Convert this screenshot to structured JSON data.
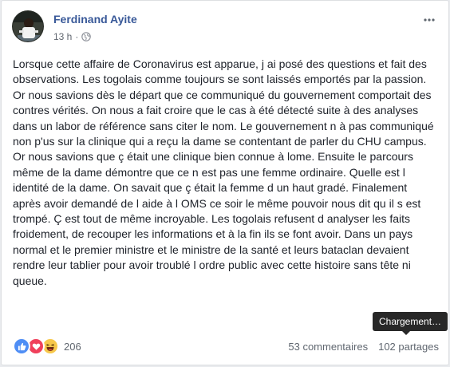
{
  "post": {
    "author": "Ferdinand Ayite",
    "time": "13 h",
    "separator": "·",
    "privacy_icon": "globe-icon",
    "more_icon": "ellipsis-icon",
    "text": "Lorsque cette affaire de Coronavirus est apparue, j ai posé des questions et fait des observations. Les togolais comme toujours se sont laissés emportés par la passion. Or nous savions dès le départ que ce communiqué du gouvernement comportait des contres vérités. On nous a fait croire que le cas à été détecté suite à des analyses dans un labor de référence sans citer le nom. Le gouvernement n à pas communiqué non p'us sur la clinique qui a reçu la dame se contentant de parler du CHU campus. Or nous savions que ç était une clinique bien connue à lome. Ensuite le parcours même de la dame démontre que ce n est pas une femme ordinaire. Quelle est l identité de la dame. On savait que ç était la femme d un haut gradé. Finalement après avoir demandé de l aide à l OMS ce soir le même pouvoir nous dit qu il s est trompé. Ç est tout de même incroyable. Les togolais refusent d analyser les faits froidement, de recouper les informations et à la fin ils se font avoir. Dans un pays normal et le premier ministre et le ministre de la santé et leurs bataclan devaient rendre leur tablier pour avoir troublé l ordre public avec cette histoire sans tête ni queue."
  },
  "footer": {
    "reaction_icons": [
      "like-icon",
      "love-icon",
      "haha-icon"
    ],
    "reaction_count": "206",
    "comments": "53 commentaires",
    "shares": "102 partages"
  },
  "tooltip": {
    "text": "Chargement…"
  },
  "colors": {
    "author_link": "#385898",
    "like": "#4f8ef5",
    "love": "#f0405b",
    "haha": "#f7c84b",
    "tooltip_bg": "#282828"
  }
}
